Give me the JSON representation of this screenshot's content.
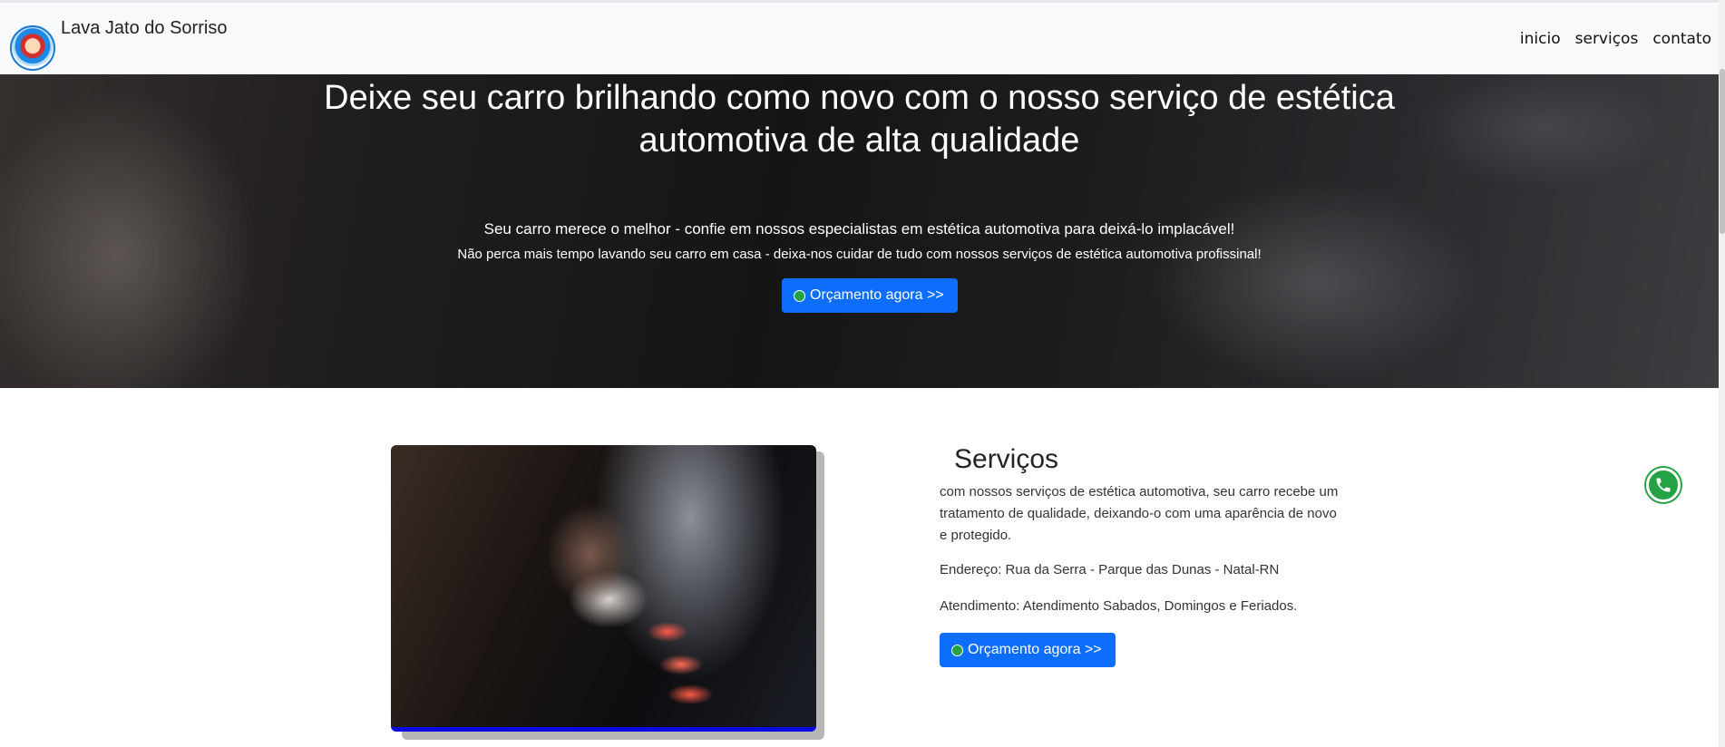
{
  "navbar": {
    "brand": "Lava Jato do Sorriso",
    "links": [
      {
        "label": "inicio"
      },
      {
        "label": "serviços"
      },
      {
        "label": "contato"
      }
    ]
  },
  "hero": {
    "title": "Deixe seu carro brilhando como novo com o nosso serviço de estética automotiva de alta qualidade",
    "subtitle": "Seu carro merece o melhor - confie em nossos especialistas em estética automotiva para deixá-lo implacável!",
    "subtitle2": "Não perca mais tempo lavando seu carro em casa - deixa-nos cuidar de tudo com nossos serviços de estética automotiva profissinal!",
    "cta_label": "Orçamento agora >>"
  },
  "services": {
    "title": "Serviços",
    "description": "com nossos serviços de estética automotiva, seu carro recebe um tratamento de qualidade, deixando-o com uma aparência de novo e protegido.",
    "address": "Endereço: Rua da Serra - Parque das Dunas - Natal-RN",
    "hours": "Atendimento: Atendimento Sabados, Domingos e Feriados.",
    "cta_label": "Orçamento agora >>"
  },
  "icons": {
    "whatsapp": "whatsapp-icon",
    "logo": "car-wash-logo"
  },
  "colors": {
    "primary_button": "#0d6efd",
    "whatsapp": "#25a244",
    "image_accent": "#0a0ae0"
  }
}
